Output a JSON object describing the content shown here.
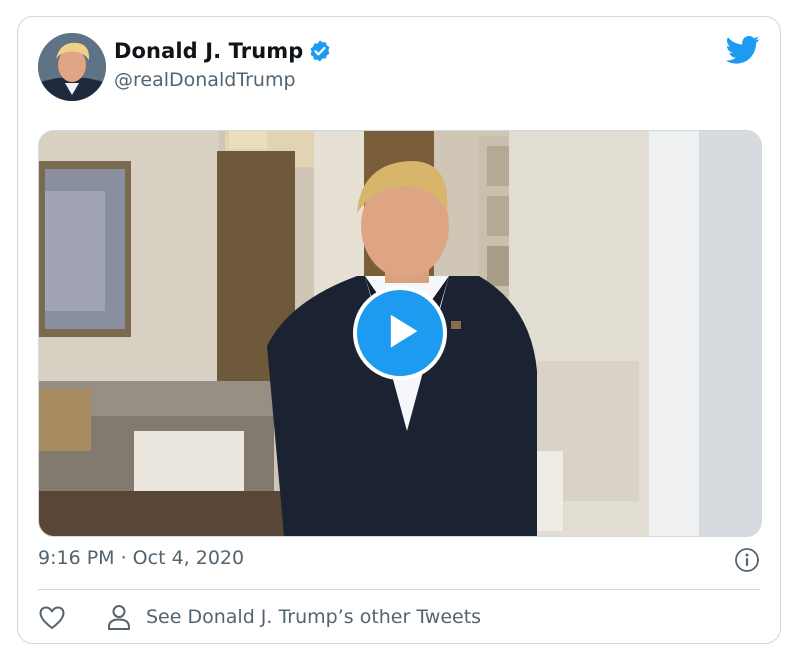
{
  "tweet": {
    "author": {
      "display_name": "Donald J. Trump",
      "handle": "@realDonaldTrump",
      "verified": true
    },
    "timestamp": "9:16 PM · Oct 4, 2020",
    "media": {
      "type": "video"
    },
    "actions": {
      "other_tweets_label": "See Donald J. Trump’s other Tweets"
    }
  },
  "icons": {
    "brand": "twitter-bird-icon",
    "verified": "verified-badge-icon",
    "play": "play-icon",
    "info": "info-icon",
    "like": "heart-icon",
    "profile": "person-icon"
  },
  "colors": {
    "brand_blue": "#1d9bf0",
    "text_primary": "#0f1419",
    "text_secondary": "#536471",
    "border": "#cfd9de"
  }
}
